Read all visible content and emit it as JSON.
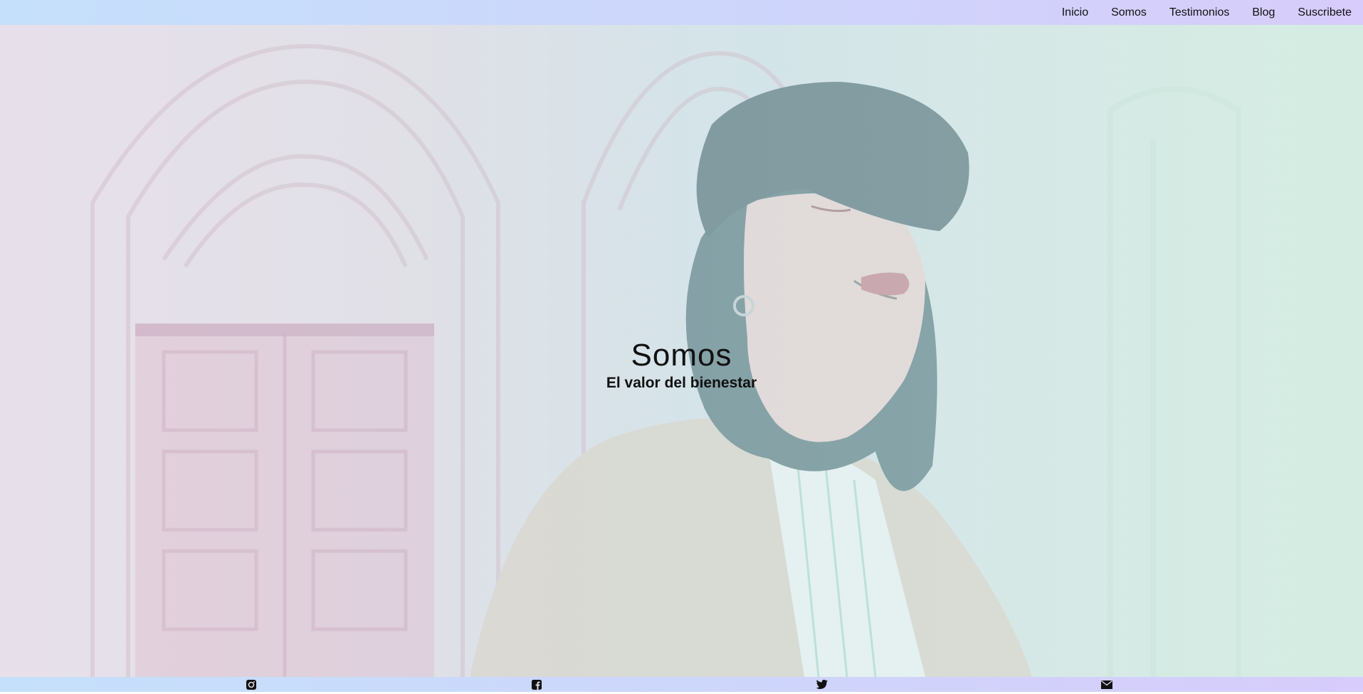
{
  "nav": {
    "items": [
      {
        "label": "Inicio"
      },
      {
        "label": "Somos"
      },
      {
        "label": "Testimonios"
      },
      {
        "label": "Blog"
      },
      {
        "label": "Suscribete"
      }
    ]
  },
  "hero": {
    "title": "Somos",
    "subtitle": "El valor del bienestar",
    "image": "woman-with-cap-in-front-of-church-doors"
  },
  "footer": {
    "icons": [
      "instagram-icon",
      "facebook-icon",
      "twitter-icon",
      "mail-icon"
    ]
  },
  "colors": {
    "bar_start": "#c5e0fb",
    "bar_end": "#d7ccfb",
    "text": "#111111"
  }
}
